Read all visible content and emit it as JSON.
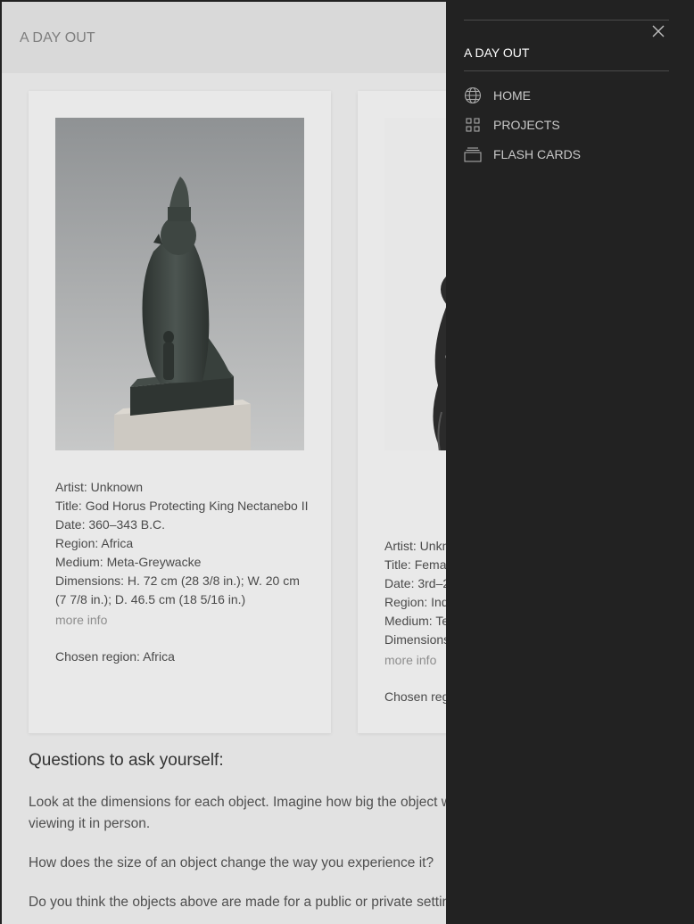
{
  "header": {
    "brand": "A DAY OUT"
  },
  "cards": [
    {
      "artist": "Artist: Unknown",
      "title": "Title: God Horus Protecting King Nectanebo II",
      "date": "Date: 360–343 B.C.",
      "region": "Region: Africa",
      "medium": "Medium: Meta-Greywacke",
      "dimensions": "Dimensions: H. 72 cm (28 3/8 in.); W. 20 cm (7 7/8 in.); D. 46.5 cm (18 5/16 in.)",
      "more": "more info",
      "chosen": "Chosen region: Africa"
    },
    {
      "artist": "Artist: Unkn",
      "title": "Title: Femal",
      "date": "Date: 3rd–2",
      "region": "Region: Ind",
      "medium": "Medium: Te",
      "dimensions": "Dimensions",
      "more": "more info",
      "chosen": "Chosen reg"
    }
  ],
  "questions": {
    "heading": "Questions to ask yourself:",
    "items": [
      "Look at the dimensions for each object. Imagine how big the object w viewing it in person.",
      "How does the size of an object change the way you experience it?",
      "Do you think the objects above are made for a public or private settin"
    ]
  },
  "drawer": {
    "title": "A DAY OUT",
    "nav": [
      {
        "label": "HOME",
        "icon": "globe-icon"
      },
      {
        "label": "PROJECTS",
        "icon": "grid-icon"
      },
      {
        "label": "FLASH CARDS",
        "icon": "cards-icon"
      }
    ]
  }
}
